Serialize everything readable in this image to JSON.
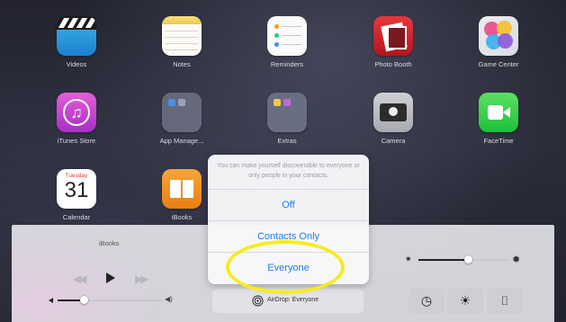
{
  "home_screen": {
    "apps": [
      {
        "id": "videos",
        "label": "Videos"
      },
      {
        "id": "notes",
        "label": "Notes"
      },
      {
        "id": "reminders",
        "label": "Reminders"
      },
      {
        "id": "photobooth",
        "label": "Photo Booth"
      },
      {
        "id": "gamecenter",
        "label": "Game Center"
      },
      {
        "id": "itunes",
        "label": "iTunes Store"
      },
      {
        "id": "appmanage",
        "label": "App Manage..."
      },
      {
        "id": "extras",
        "label": "Extras"
      },
      {
        "id": "camera",
        "label": "Camera"
      },
      {
        "id": "facetime",
        "label": "FaceTime"
      },
      {
        "id": "calendar",
        "label": "Calendar",
        "day_of_week": "Tuesday",
        "day_number": "31"
      },
      {
        "id": "ibooks",
        "label": "iBooks"
      }
    ]
  },
  "control_center": {
    "now_playing": {
      "title": "iBooks"
    },
    "playback": {
      "rewind_icon": "rewind-icon",
      "play_icon": "play-icon",
      "forward_icon": "fast-forward-icon"
    },
    "volume_level": 0.25,
    "brightness_level": 0.55,
    "airdrop": {
      "label": "AirDrop: Everyone",
      "icon": "airdrop-icon"
    },
    "quick_tiles": [
      {
        "id": "timer",
        "icon": "timer-icon"
      },
      {
        "id": "brightness",
        "icon": "sun-icon"
      },
      {
        "id": "camera",
        "icon": "camera-icon"
      }
    ]
  },
  "airdrop_popup": {
    "description": "You can make yourself discoverable to everyone or only people in your contacts.",
    "options": [
      {
        "label": "Off"
      },
      {
        "label": "Contacts Only"
      },
      {
        "label": "Everyone"
      }
    ],
    "selected": "Everyone"
  },
  "colors": {
    "accent": "#1b7cf5",
    "highlight_ring": "#f4ec21"
  }
}
